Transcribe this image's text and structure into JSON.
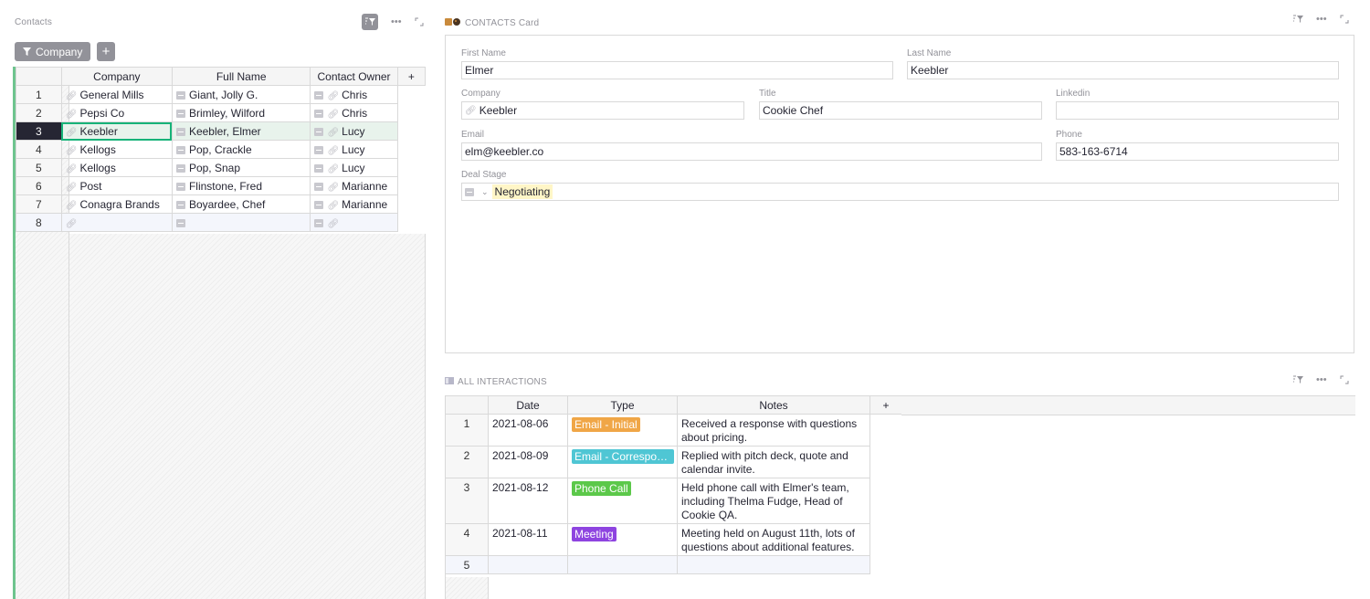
{
  "contacts_section": {
    "title": "Contacts",
    "filter_label": "Company",
    "add_filter_label": "+",
    "columns": [
      "Company",
      "Full Name",
      "Contact Owner"
    ],
    "add_column_label": "+",
    "rows": [
      {
        "n": "1",
        "company": "General Mills",
        "full_name": "Giant, Jolly G.",
        "owner": "Chris"
      },
      {
        "n": "2",
        "company": "Pepsi Co",
        "full_name": "Brimley, Wilford",
        "owner": "Chris"
      },
      {
        "n": "3",
        "company": "Keebler",
        "full_name": "Keebler, Elmer",
        "owner": "Lucy"
      },
      {
        "n": "4",
        "company": "Kellogs",
        "full_name": "Pop, Crackle",
        "owner": "Lucy"
      },
      {
        "n": "5",
        "company": "Kellogs",
        "full_name": "Pop, Snap",
        "owner": "Lucy"
      },
      {
        "n": "6",
        "company": "Post",
        "full_name": "Flinstone, Fred",
        "owner": "Marianne"
      },
      {
        "n": "7",
        "company": "Conagra Brands",
        "full_name": "Boyardee, Chef",
        "owner": "Marianne"
      },
      {
        "n": "8",
        "company": "",
        "full_name": "",
        "owner": ""
      }
    ]
  },
  "card": {
    "title": "CONTACTS Card",
    "first_name": {
      "label": "First Name",
      "value": "Elmer"
    },
    "last_name": {
      "label": "Last Name",
      "value": "Keebler"
    },
    "company": {
      "label": "Company",
      "value": "Keebler"
    },
    "title_field": {
      "label": "Title",
      "value": "Cookie Chef"
    },
    "linkedin": {
      "label": "Linkedin",
      "value": ""
    },
    "email": {
      "label": "Email",
      "value": "elm@keebler.co"
    },
    "phone": {
      "label": "Phone",
      "value": "583-163-6714"
    },
    "deal_stage": {
      "label": "Deal Stage",
      "value": "Negotiating"
    }
  },
  "interactions": {
    "title": "ALL INTERACTIONS",
    "columns": [
      "Date",
      "Type",
      "Notes"
    ],
    "add_column_label": "+",
    "rows": [
      {
        "n": "1",
        "date": "2021-08-06",
        "type": "Email - Initial",
        "type_color": "#f0a646",
        "notes": "Received a response with questions about pricing."
      },
      {
        "n": "2",
        "date": "2021-08-09",
        "type": "Email - Correspondence",
        "type_color": "#4fc6d4",
        "notes": "Replied with pitch deck, quote and calendar invite."
      },
      {
        "n": "3",
        "date": "2021-08-12",
        "type": "Phone Call",
        "type_color": "#5cc84a",
        "notes": "Held phone call with Elmer's team, including Thelma Fudge, Head of Cookie QA."
      },
      {
        "n": "4",
        "date": "2021-08-11",
        "type": "Meeting",
        "type_color": "#8e44e0",
        "notes": "Meeting held on August 11th, lots of questions about additional features."
      },
      {
        "n": "5",
        "date": "",
        "type": "",
        "type_color": "",
        "notes": ""
      }
    ]
  },
  "icons": {
    "filter": "filter-icon",
    "more": "more-icon",
    "expand": "expand-icon",
    "link": "link-icon",
    "reference": "reference-icon",
    "card_emoji": "cookie-icon"
  },
  "colors": {
    "selection_green": "#16b378",
    "row_bar": "#6ec48e",
    "active_row_number": "#262633",
    "choice_highlight": "#fff6c7"
  }
}
